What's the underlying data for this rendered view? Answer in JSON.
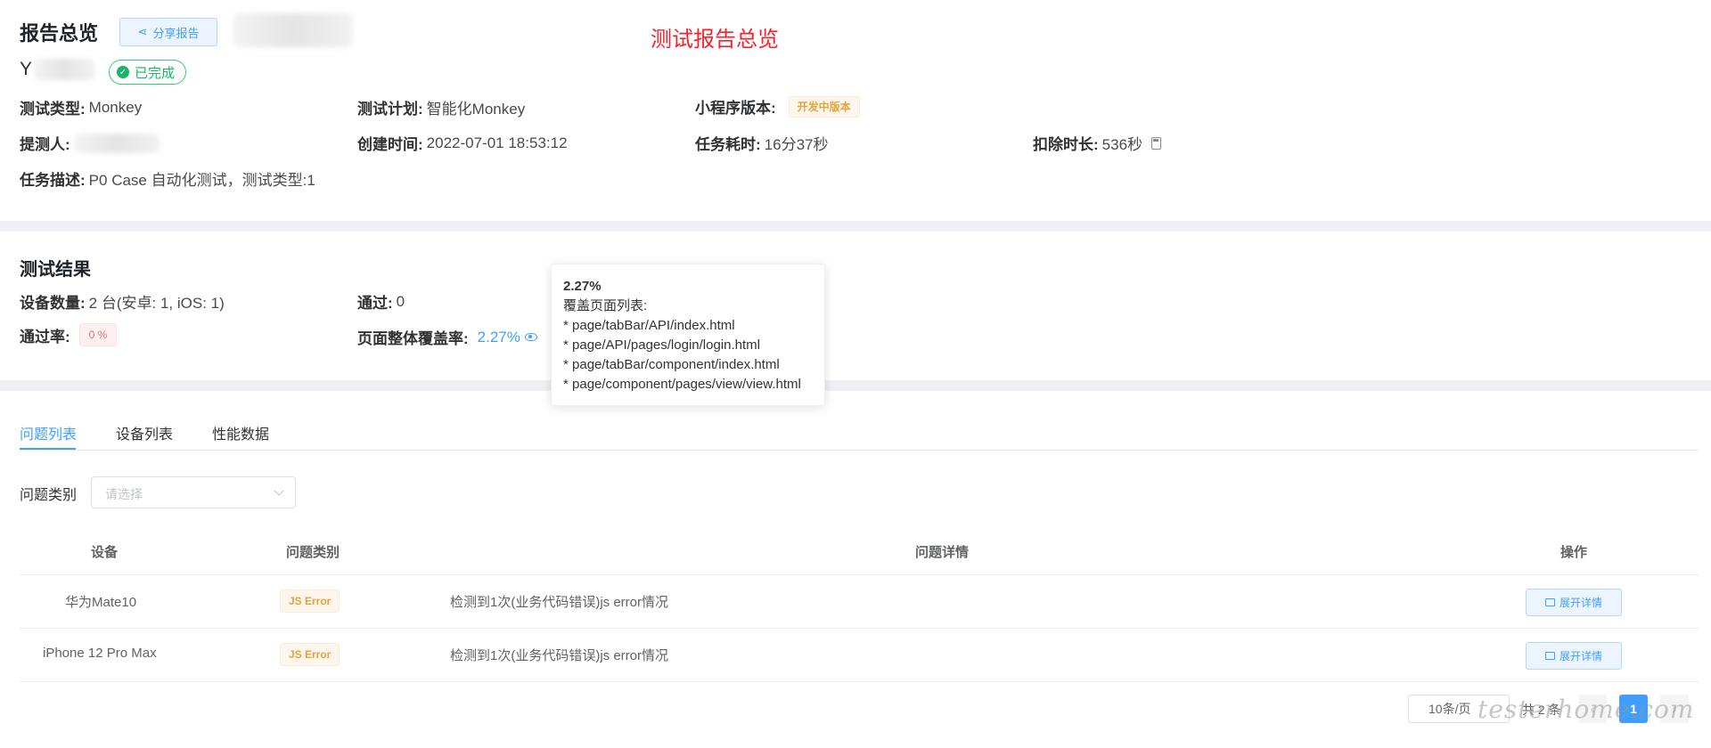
{
  "header": {
    "title": "报告总览",
    "share_label": "分享报告",
    "red_note": "测试报告总览",
    "name_initial": "Y",
    "status": "已完成"
  },
  "info": {
    "test_type": {
      "k": "测试类型:",
      "v": "Monkey"
    },
    "test_plan": {
      "k": "测试计划:",
      "v": "智能化Monkey"
    },
    "version": {
      "k": "小程序版本:",
      "tag": "开发中版本"
    },
    "submitter": {
      "k": "提测人:"
    },
    "created": {
      "k": "创建时间:",
      "v": "2022-07-01 18:53:12"
    },
    "duration": {
      "k": "任务耗时:",
      "v": "16分37秒"
    },
    "deduct": {
      "k": "扣除时长:",
      "v": "536秒"
    },
    "desc": {
      "k": "任务描述:",
      "v": "P0 Case 自动化测试，测试类型:1"
    }
  },
  "results": {
    "title": "测试结果",
    "devices": {
      "k": "设备数量:",
      "v": "2 台(安卓: 1, iOS: 1)"
    },
    "passed": {
      "k": "通过:",
      "v": "0"
    },
    "pass_rate": {
      "k": "通过率:",
      "v": "0 %"
    },
    "coverage": {
      "k": "页面整体覆盖率:",
      "v": "2.27%"
    }
  },
  "tooltip": {
    "title": "2.27%",
    "subtitle": "覆盖页面列表:",
    "pages": [
      "* page/tabBar/API/index.html",
      "* page/API/pages/login/login.html",
      "* page/tabBar/component/index.html",
      "* page/component/pages/view/view.html"
    ]
  },
  "tabs": [
    "问题列表",
    "设备列表",
    "性能数据"
  ],
  "filter": {
    "label": "问题类别",
    "placeholder": "请选择"
  },
  "table": {
    "headers": [
      "设备",
      "问题类别",
      "问题详情",
      "操作"
    ],
    "rows": [
      {
        "device": "华为Mate10",
        "category": "JS Error",
        "detail": "检测到1次(业务代码错误)js error情况",
        "action": "展开详情"
      },
      {
        "device": "iPhone 12 Pro Max",
        "category": "JS Error",
        "detail": "检测到1次(业务代码错误)js error情况",
        "action": "展开详情"
      }
    ]
  },
  "pager": {
    "size": "10条/页",
    "total": "共 2 条",
    "current": "1",
    "prev": "‹",
    "next": "›"
  },
  "watermark": "testerhome.com",
  "colors": {
    "primary": "#409eff",
    "success": "#18b566",
    "warning": "#e6a23c",
    "danger": "#f56c6c",
    "note_red": "#f5222d"
  }
}
